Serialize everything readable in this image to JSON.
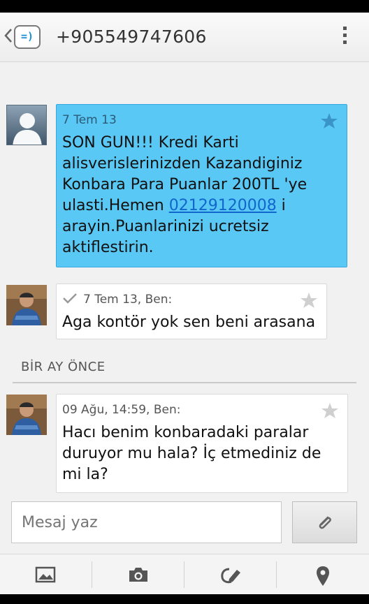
{
  "header": {
    "title": "+905549747606",
    "back_icon": "chevron-left-icon",
    "app_icon": "messaging-app-icon",
    "menu_icon": "overflow-menu-icon"
  },
  "messages": [
    {
      "direction": "incoming",
      "meta": "7 Tem 13",
      "text_before": "SON GUN!!! Kredi Karti alisverislerinizden Kazandiginiz Konbara Para Puanlar 200TL 'ye ulasti.Hemen ",
      "link": "02129120008",
      "text_after": " i arayin.Puanlarinizi ucretsiz aktiflestirin.",
      "starred": true
    },
    {
      "direction": "outgoing",
      "meta": "7 Tem 13, Ben:",
      "text": "Aga kontör yok sen beni arasana",
      "starred": false
    },
    {
      "direction": "outgoing",
      "meta": "09 Ağu, 14:59, Ben:",
      "text": "Hacı benim konbaradaki paralar duruyor mu hala? İç etmediniz de mi la?",
      "starred": false
    }
  ],
  "section": {
    "label": "BİR AY ÖNCE"
  },
  "compose": {
    "placeholder": "Mesaj yaz",
    "attach_icon": "paperclip-icon"
  },
  "bottom_bar": {
    "icons": [
      "gallery-icon",
      "camera-icon",
      "sketch-icon",
      "location-pin-icon"
    ]
  },
  "colors": {
    "incoming_bubble": "#5ac8f5",
    "outgoing_bubble": "#ffffff",
    "link": "#1166cc",
    "background": "#f1f1f1"
  }
}
